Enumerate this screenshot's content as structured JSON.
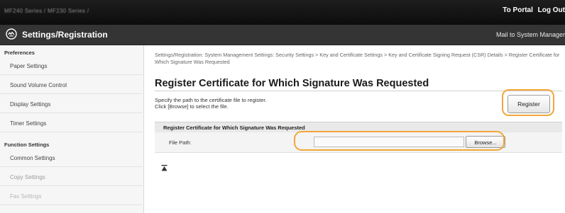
{
  "topbar": {
    "model": "MF240 Series / MF230 Series /",
    "portal_link": "To Portal",
    "logout_link": "Log Out"
  },
  "header": {
    "title": "Settings/Registration",
    "mail_link": "Mail to System Manager"
  },
  "sidebar": {
    "sections": [
      {
        "label": "Preferences"
      },
      {
        "label": "Function Settings"
      }
    ],
    "items": [
      {
        "label": "Paper Settings"
      },
      {
        "label": "Sound Volume Control"
      },
      {
        "label": "Display Settings"
      },
      {
        "label": "Timer Settings"
      },
      {
        "label": "Common Settings"
      },
      {
        "label": "Copy Settings"
      },
      {
        "label": "Fax Settings"
      }
    ]
  },
  "main": {
    "breadcrumb": "Settings/Registration: System Management Settings: Security Settings > Key and Certificate Settings > Key and Certificate Signing Request (CSR) Details > Register Certificate for Which Signature Was Requested",
    "title": "Register Certificate for Which Signature Was Requested",
    "desc_line1": "Specify the path to the certificate file to register.",
    "desc_line2": "Click [Browse] to select the file.",
    "register_label": "Register",
    "section_title": "Register Certificate for Which Signature Was Requested",
    "field_label": "File Path:",
    "file_path_value": "",
    "browse_label": "Browse..."
  },
  "colors": {
    "highlight": "#f3a63a",
    "topbar": "#111111",
    "header": "#343434"
  },
  "icons": [
    "settings-logo-icon",
    "page-top-icon"
  ]
}
